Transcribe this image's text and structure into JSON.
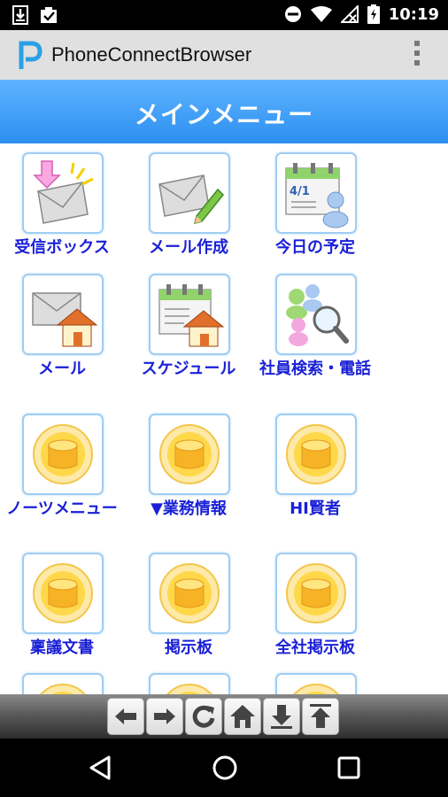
{
  "status_bar": {
    "time": "10:19"
  },
  "app": {
    "title": "PhoneConnectBrowser"
  },
  "header": {
    "title": "メインメニュー"
  },
  "menu": [
    {
      "label": "受信ボックス",
      "icon": "inbox-icon"
    },
    {
      "label": "メール作成",
      "icon": "compose-mail-icon"
    },
    {
      "label": "今日の予定",
      "icon": "today-schedule-icon"
    },
    {
      "label": "メール",
      "icon": "mail-home-icon"
    },
    {
      "label": "スケジュール",
      "icon": "schedule-home-icon"
    },
    {
      "label": "社員検索・電話",
      "icon": "employee-search-icon"
    },
    {
      "label": "ノーツメニュー",
      "icon": "database-icon"
    },
    {
      "label": "▼業務情報",
      "icon": "database-icon"
    },
    {
      "label": "HI賢者",
      "icon": "database-icon"
    },
    {
      "label": "稟議文書",
      "icon": "database-icon"
    },
    {
      "label": "掲示板",
      "icon": "database-icon"
    },
    {
      "label": "全社掲示板",
      "icon": "database-icon"
    }
  ],
  "toolbar": [
    "back-icon",
    "forward-icon",
    "reload-icon",
    "home-icon",
    "download-icon",
    "scroll-top-icon"
  ],
  "colors": {
    "header": "#3d9cf5",
    "label": "#1a20d6",
    "accent": "#2aa0e6"
  }
}
